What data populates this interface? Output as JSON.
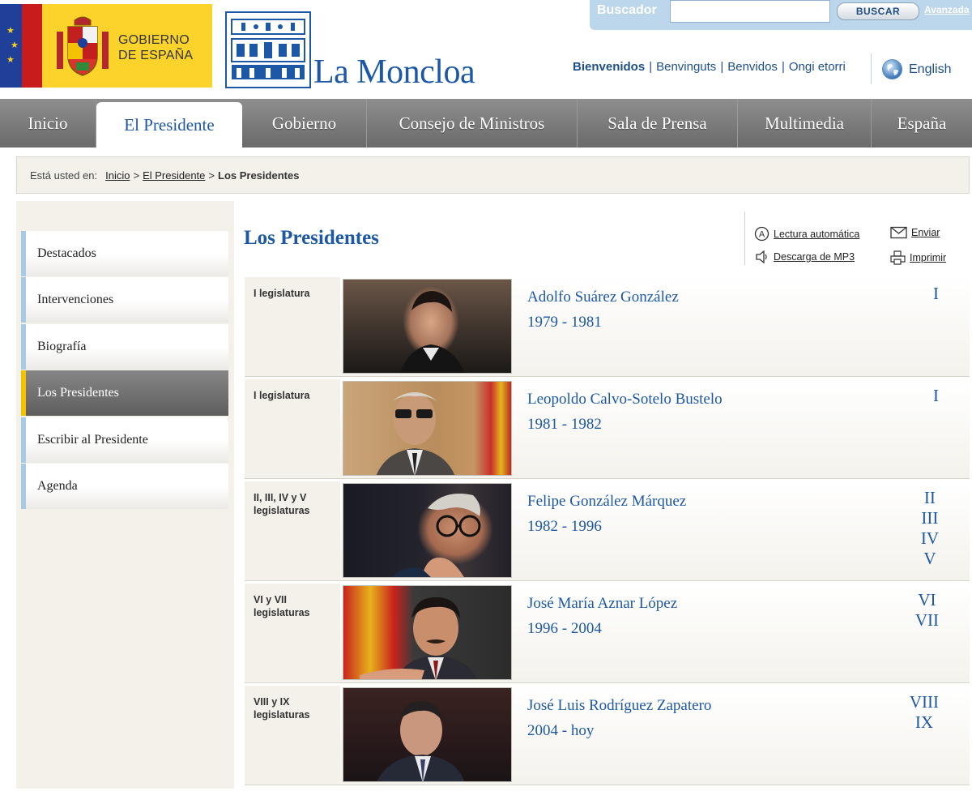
{
  "header": {
    "gobierno_line1": "GOBIERNO",
    "gobierno_line2": "DE ESPAÑA",
    "site_name": "La Moncloa",
    "search": {
      "label": "Buscador",
      "placeholder": "",
      "button": "BUSCAR",
      "advanced": "Avanzada"
    },
    "languages": [
      "Bienvenidos",
      "Benvinguts",
      "Benvidos",
      "Ongi etorri"
    ],
    "english": "English"
  },
  "nav": {
    "items": [
      "Inicio",
      "El Presidente",
      "Gobierno",
      "Consejo de Ministros",
      "Sala de Prensa",
      "Multimedia",
      "España"
    ],
    "active": "El Presidente"
  },
  "breadcrumb": {
    "label": "Está usted en:",
    "links": [
      "Inicio",
      "El Presidente"
    ],
    "separator": ">",
    "current": "Los Presidentes"
  },
  "sidebar": {
    "items": [
      "Destacados",
      "Intervenciones",
      "Biografía",
      "Los Presidentes",
      "Escribir al Presidente",
      "Agenda"
    ],
    "active": "Los Presidentes"
  },
  "main": {
    "title": "Los Presidentes",
    "tools": {
      "lectura": "Lectura automática",
      "enviar": "Enviar",
      "mp3": "Descarga de MP3",
      "imprimir": "Imprimir"
    },
    "presidents": [
      {
        "legislatura_1": "I legislatura",
        "legislatura_2": "",
        "name": "Adolfo Suárez González",
        "years": "1979 - 1981",
        "roman": [
          "I"
        ]
      },
      {
        "legislatura_1": "I legislatura",
        "legislatura_2": "",
        "name": "Leopoldo Calvo-Sotelo Bustelo",
        "years": "1981 - 1982",
        "roman": [
          "I"
        ]
      },
      {
        "legislatura_1": "II, III, IV y V",
        "legislatura_2": "legislaturas",
        "name": "Felipe González Márquez",
        "years": "1982 - 1996",
        "roman": [
          "II",
          "III",
          "IV",
          "V"
        ]
      },
      {
        "legislatura_1": "VI y VII",
        "legislatura_2": "legislaturas",
        "name": "José María Aznar López",
        "years": "1996 - 2004",
        "roman": [
          "VI",
          "VII"
        ]
      },
      {
        "legislatura_1": "VIII y IX",
        "legislatura_2": "legislaturas",
        "name": "José Luis Rodríguez Zapatero",
        "years": "2004 - hoy",
        "roman": [
          "VIII",
          "IX"
        ]
      }
    ]
  },
  "colors": {
    "link_blue": "#1d58a6",
    "nav_gray": "#7c7c7c",
    "sidebar_accent": "#a6cbe6",
    "sidebar_active_accent": "#f2c100",
    "panel_beige": "#f3f1ea"
  }
}
